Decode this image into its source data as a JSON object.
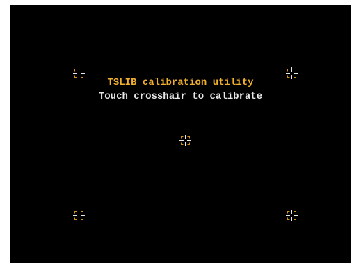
{
  "screen": {
    "title": "TSLIB calibration utility",
    "subtitle": "Touch crosshair to calibrate"
  },
  "colors": {
    "background": "#000000",
    "title": "#f0b030",
    "subtitle": "#e8e8e8",
    "crosshair_lines": "#e8e8e8",
    "crosshair_corners": "#d09020"
  },
  "icons": {
    "crosshair": "crosshair-icon"
  }
}
